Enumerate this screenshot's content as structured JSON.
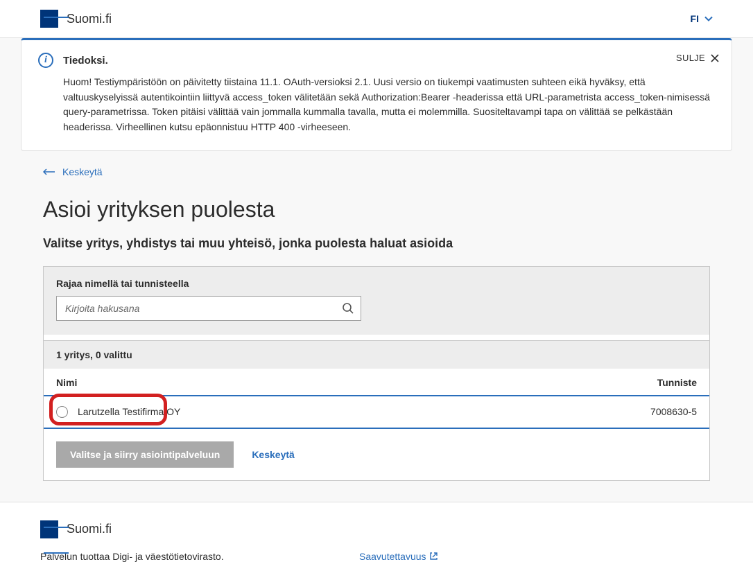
{
  "header": {
    "brand": "Suomi.fi",
    "language": "FI"
  },
  "alert": {
    "title": "Tiedoksi.",
    "body": "Huom! Testiympäristöön on päivitetty tiistaina 11.1. OAuth-versioksi 2.1. Uusi versio on tiukempi vaatimusten suhteen eikä hyväksy, että valtuuskyselyissä autentikointiin liittyvä access_token välitetään sekä Authorization:Bearer -headerissa että URL-parametrista access_token-nimisessä query-parametrissa. Token pitäisi välittää vain jommalla kummalla tavalla, mutta ei molemmilla. Suositeltavampi tapa on välittää se pelkästään headerissa. Virheellinen kutsu epäonnistuu HTTP 400 -virheeseen.",
    "close": "SULJE"
  },
  "nav": {
    "back": "Keskeytä"
  },
  "page": {
    "title": "Asioi yrityksen puolesta",
    "subtitle": "Valitse yritys, yhdistys tai muu yhteisö, jonka puolesta haluat asioida"
  },
  "filter": {
    "label": "Rajaa nimellä tai tunnisteella",
    "placeholder": "Kirjoita hakusana"
  },
  "count_bar": "1 yritys, 0 valittu",
  "table": {
    "col_name": "Nimi",
    "col_id": "Tunniste",
    "rows": [
      {
        "name": "Larutzella Testifirma OY",
        "id": "7008630-5"
      }
    ]
  },
  "actions": {
    "submit": "Valitse ja siirry asiointipalveluun",
    "cancel": "Keskeytä"
  },
  "footer": {
    "brand": "Suomi.fi",
    "provider": "Palvelun tuottaa Digi- ja väestötietovirasto.",
    "a11y": "Saavutettavuus"
  }
}
